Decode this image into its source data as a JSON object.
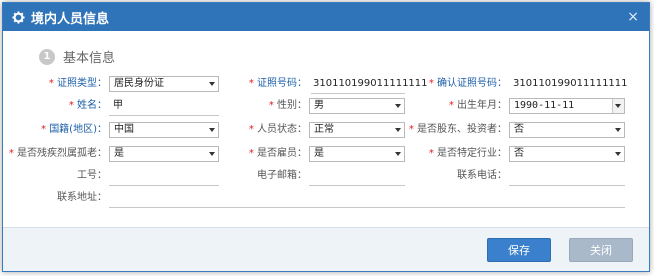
{
  "dialog": {
    "title": "境内人员信息",
    "close_glyph": "×"
  },
  "section": {
    "step": "1",
    "title": "基本信息"
  },
  "labels": {
    "id_type": "证照类型：",
    "id_number": "证照号码：",
    "confirm_id_number": "确认证照号码：",
    "name": "姓名：",
    "gender": "性别：",
    "birth_date": "出生年月：",
    "nationality": "国籍(地区)：",
    "status": "人员状态：",
    "is_shareholder": "是否股东、投资者：",
    "is_disabled": "是否残疾烈属孤老：",
    "is_employee": "是否雇员：",
    "is_special_industry": "是否特定行业：",
    "employee_no": "工号：",
    "email": "电子邮箱：",
    "phone": "联系电话：",
    "address": "联系地址："
  },
  "values": {
    "id_type": "居民身份证",
    "id_number": "310110199011111111",
    "confirm_id_number": "310110199011111111",
    "name": "甲",
    "gender": "男",
    "birth_date": "1990-11-11",
    "nationality": "中国",
    "status": "正常",
    "is_shareholder": "否",
    "is_disabled": "是",
    "is_employee": "是",
    "is_special_industry": "否",
    "employee_no": "",
    "email": "",
    "phone": "",
    "address": ""
  },
  "required_mark": "*",
  "buttons": {
    "save": "保存",
    "close": "关闭"
  }
}
